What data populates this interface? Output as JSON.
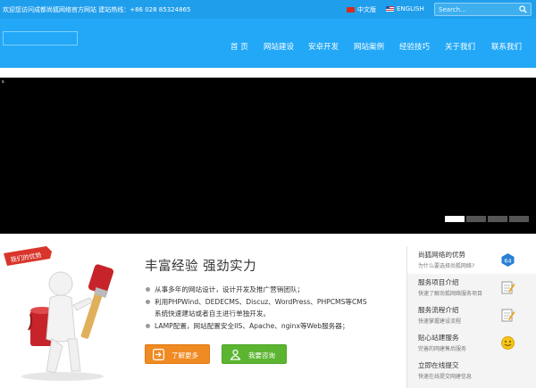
{
  "topbar": {
    "welcome": "欢迎您访问成都尚狐网络官方网站  建站热线：+86 028 85324865",
    "lang_cn": "中文版",
    "lang_en": "ENGLISH",
    "search_placeholder": "Search...",
    "search_icon": "search-icon"
  },
  "nav": {
    "items": [
      "首 页",
      "网站建设",
      "安卓开发",
      "网站案例",
      "经验技巧",
      "关于我们",
      "联系我们"
    ]
  },
  "banner": {
    "tiny_mark": "s",
    "slide_count": 4,
    "active_slide": 1
  },
  "feature": {
    "ribbon_text": "我们的优势",
    "title": "丰富经验 强劲实力",
    "bullets": [
      "从事多年的网站设计，设计开发及推广营销团队；",
      "利用PHPWind、DEDECMS、Discuz、WordPress、PHPCMS等CMS",
      "系统快速建站或者自主进行单独开发。",
      "LAMP配置，网站配置安全IIS、Apache、nginx等Web服务器；"
    ],
    "btn_more": "了解更多",
    "btn_consult": "我要咨询",
    "colors": {
      "orange": "#f08a22",
      "green": "#5cb531",
      "ribbon": "#d9352b"
    }
  },
  "sidebar": {
    "items": [
      {
        "title": "尚狐网络的优势",
        "sub": "为什么要选择尚狐网络?",
        "icon": "badge-64-icon"
      },
      {
        "title": "服务项目介绍",
        "sub": "快速了解尚狐网络服务项目",
        "icon": "edit-note-icon"
      },
      {
        "title": "服务流程介绍",
        "sub": "快速掌握建设流程",
        "icon": "edit-note-icon"
      },
      {
        "title": "贴心站建服务",
        "sub": "完善的网建售后服务",
        "icon": "smiley-icon"
      },
      {
        "title": "立即在线提交",
        "sub": "快速在线提交网建信息",
        "icon": ""
      }
    ]
  },
  "colors": {
    "topbar": "#1f9eec",
    "header": "#22a8f7",
    "banner": "#000000"
  }
}
